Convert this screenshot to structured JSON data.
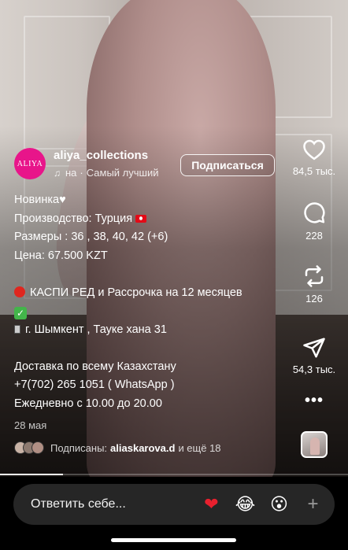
{
  "author": {
    "avatar_text": "ALIYA",
    "username": "aliya_collections",
    "music_prefix": "на",
    "music_title": "Самый лучший",
    "subscribe_label": "Подписаться"
  },
  "caption": {
    "line1": "Новинка",
    "line2": "Производство: Турция",
    "line3": "Размеры : 36 , 38, 40, 42 (+6)",
    "line4": "Цена: 67.500 KZT",
    "line5": "КАСПИ РЕД и Рассрочка на 12 месяцев",
    "line6": "г. Шымкент , Тауке хана 31",
    "line7": "Доставка по всему Казахстану",
    "line8": " +7(702) 265 1051 ( WhatsApp )",
    "line9": "Ежедневно с 10.00 до 20.00"
  },
  "date": "28 мая",
  "followers": {
    "prefix": "Подписаны:",
    "name": "aliaskarova.d",
    "suffix": "и ещё 18"
  },
  "actions": {
    "likes": "84,5 тыс.",
    "comments": "228",
    "reposts": "126",
    "shares": "54,3 тыс.",
    "more": "•••"
  },
  "progress": {
    "fraction": 0.18
  },
  "reply": {
    "placeholder": "Ответить себе...",
    "emoji_heart": "❤",
    "emoji_laugh": "😂",
    "emoji_wow": "😮",
    "plus": "+"
  },
  "colors": {
    "avatar": "#e8158a",
    "reply_bar": "#262626",
    "heart": "#e8202e"
  }
}
